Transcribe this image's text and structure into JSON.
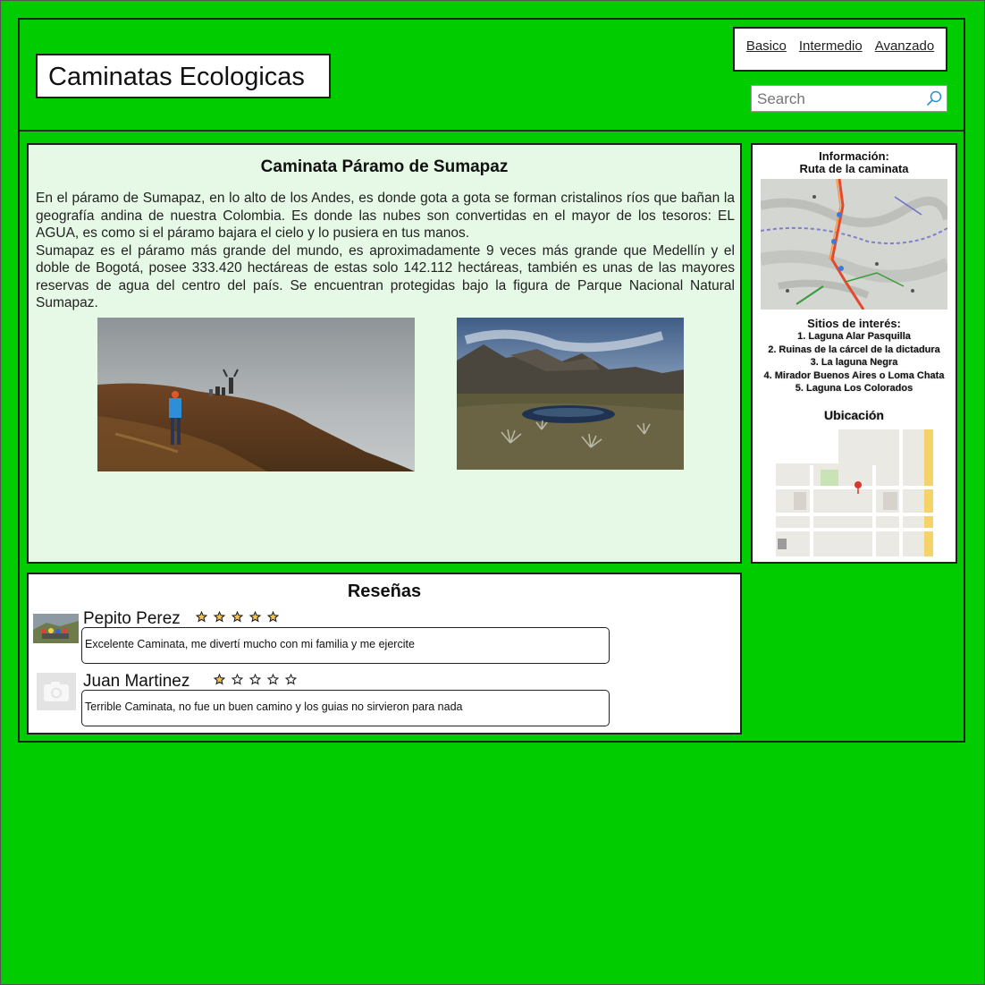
{
  "header": {
    "site_title": "Caminatas Ecologicas",
    "nav": [
      {
        "label": "Basico"
      },
      {
        "label": "Intermedio"
      },
      {
        "label": "Avanzado"
      }
    ],
    "search": {
      "placeholder": "Search"
    }
  },
  "main": {
    "title": "Caminata Páramo de Sumapaz",
    "paragraphs": [
      "En el páramo de Sumapaz, en lo alto de los Andes, es donde gota a gota se forman cristalinos ríos que bañan la geografía andina de nuestra Colombia. Es donde las nubes son convertidas en el mayor de los tesoros: EL AGUA, es como si el páramo bajara el cielo y lo pusiera en tus manos.",
      "Sumapaz es el páramo más grande del mundo, es aproximadamente 9 veces más grande que Medellín y el doble de Bogotá, posee 333.420 hectáreas de estas solo 142.112 hectáreas, también es unas de las mayores reservas de agua del centro del país. Se encuentran protegidas bajo la figura de Parque Nacional Natural Sumapaz."
    ]
  },
  "sidebar": {
    "info_title": "Información:",
    "route_title": "Ruta de la caminata",
    "sites_title": "Sitios de interés:",
    "sites": [
      "1. Laguna Alar Pasquilla",
      "2. Ruinas de la cárcel de la dictadura",
      "3. La laguna Negra",
      "4. Mirador Buenos Aires o Loma Chata",
      "5. Laguna Los Colorados"
    ],
    "location_title": "Ubicación"
  },
  "reviews": {
    "title": "Reseñas",
    "items": [
      {
        "name": "Pepito Perez",
        "rating": 5,
        "comment": "Excelente Caminata, me divertí mucho con mi familia y me ejercite"
      },
      {
        "name": "Juan Martinez",
        "rating": 1,
        "comment": "Terrible Caminata, no fue un buen camino y los guias no sirvieron para nada"
      }
    ]
  },
  "colors": {
    "page_background": "#00cc00",
    "main_panel": "#e6f8e6",
    "star_filled": "#f3c451",
    "star_empty": "#ffffff"
  }
}
